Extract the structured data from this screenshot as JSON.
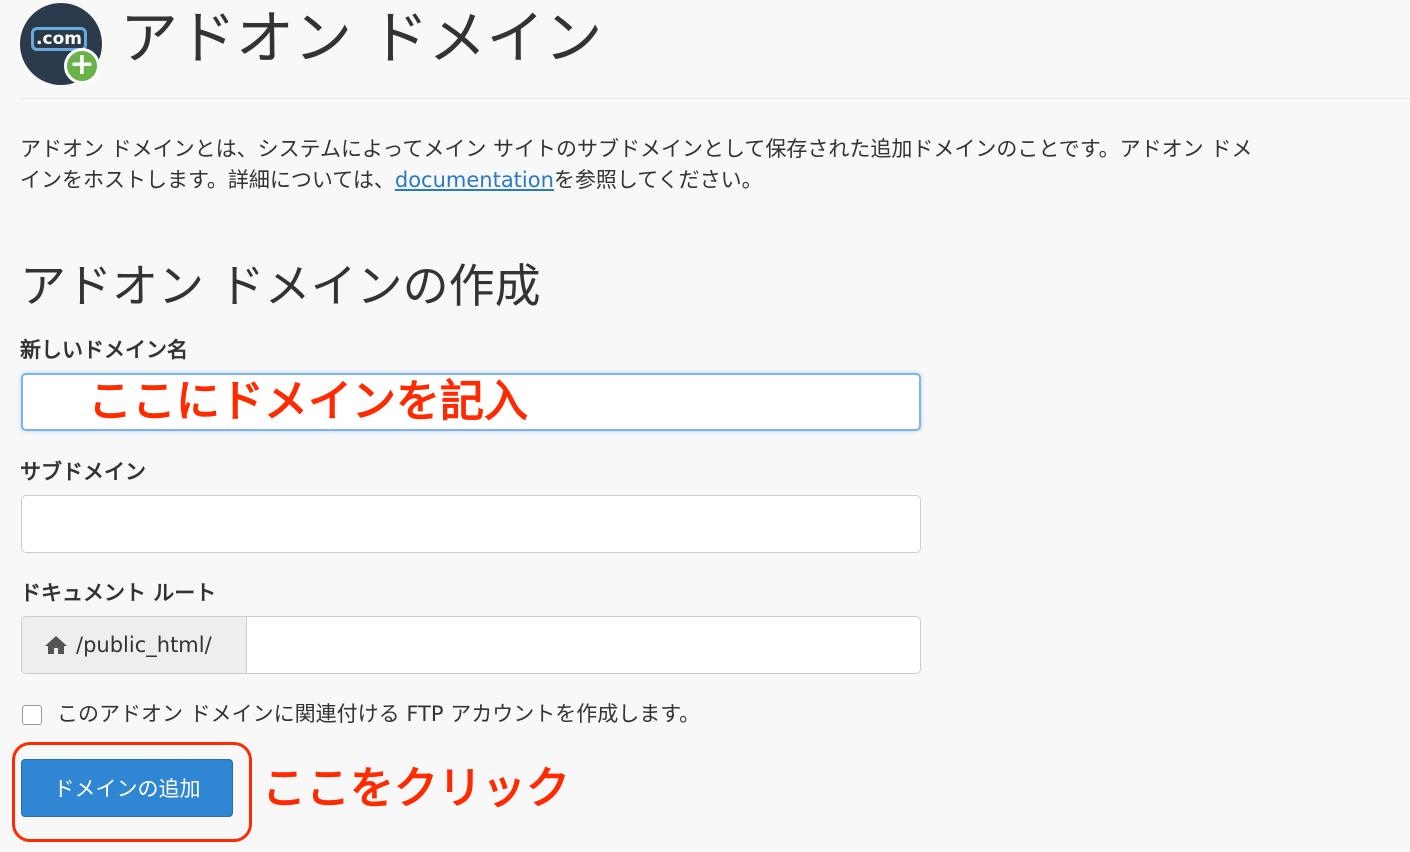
{
  "header": {
    "title": "アドオン ドメイン",
    "logo_text": ".com",
    "logo_plus": "+"
  },
  "description": {
    "line1": "アドオン ドメインとは、システムによってメイン サイトのサブドメインとして保存された追加ドメインのことです。アドオン ドメ",
    "line2_before": "インをホストします。詳細については、",
    "link_text": "documentation",
    "line2_after": "を参照してください。"
  },
  "form": {
    "section_title": "アドオン ドメインの作成",
    "new_domain_label": "新しいドメイン名",
    "new_domain_value": "",
    "subdomain_label": "サブドメイン",
    "subdomain_value": "",
    "docroot_label": "ドキュメント ルート",
    "docroot_prefix": "/public_html/",
    "docroot_value": "",
    "ftp_checkbox_label": "このアドオン ドメインに関連付ける FTP アカウントを作成します。",
    "ftp_checked": false,
    "submit_label": "ドメインの追加"
  },
  "annotations": {
    "input_hint": "ここにドメインを記入",
    "button_hint": "ここをクリック",
    "color": "#ff2a00"
  },
  "colors": {
    "primary_button": "#2f86d2",
    "link": "#2a79c4",
    "focus_border": "#7fb3e6"
  },
  "icons": {
    "logo": "dotcom-plus-icon",
    "docroot": "home-icon"
  }
}
